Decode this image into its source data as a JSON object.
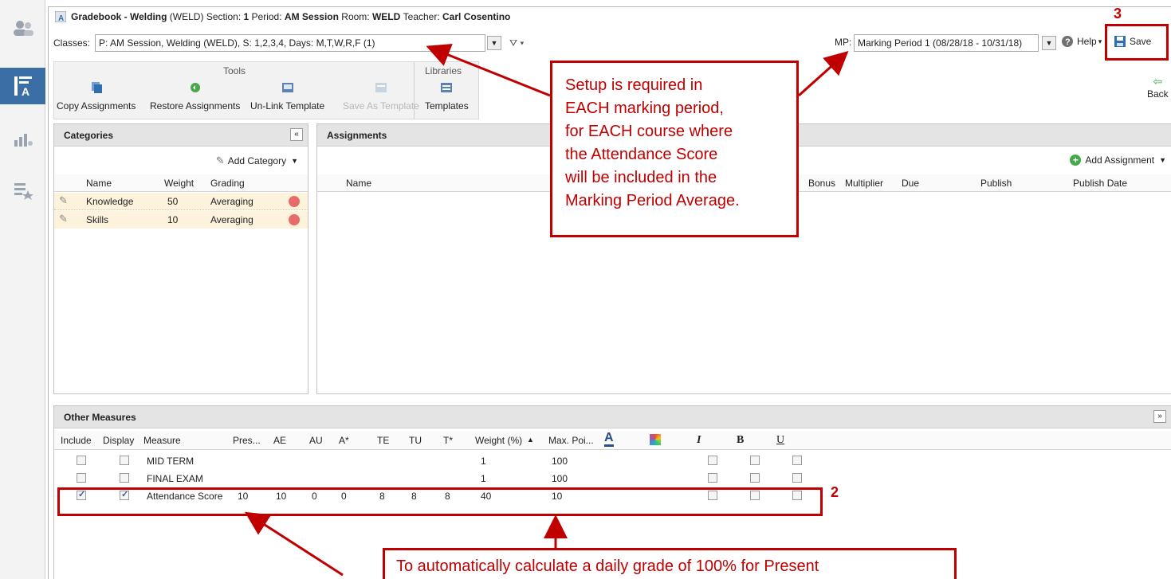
{
  "title_bar": {
    "prefix": "Gradebook - Welding",
    "course_code": "(WELD)",
    "section_label": "Section:",
    "section_value": "1",
    "period_label": "Period:",
    "period_value": "AM Session",
    "room_label": "Room:",
    "room_value": "WELD",
    "teacher_label": "Teacher:",
    "teacher_value": "Carl Cosentino"
  },
  "classes": {
    "label": "Classes:",
    "selected": "P: AM Session, Welding (WELD), S: 1,2,3,4, Days: M,T,W,R,F (1)"
  },
  "marking_period": {
    "label": "MP:",
    "selected": "Marking Period 1 (08/28/18 - 10/31/18)"
  },
  "toolbar": {
    "help_label": "Help",
    "save_label": "Save",
    "back_label": "Back"
  },
  "ribbon": {
    "tools_header": "Tools",
    "libraries_header": "Libraries",
    "buttons": [
      {
        "label": "Copy Assignments",
        "icon": "copy-icon"
      },
      {
        "label": "Restore Assignments",
        "icon": "restore-icon"
      },
      {
        "label": "Un-Link Template",
        "icon": "unlink-icon"
      },
      {
        "label": "Save As Template",
        "icon": "save-template-icon",
        "disabled": true
      },
      {
        "label": "Templates",
        "icon": "templates-icon"
      }
    ]
  },
  "categories": {
    "title": "Categories",
    "add_label": "Add Category",
    "columns": [
      "Name",
      "Weight",
      "Grading"
    ],
    "rows": [
      {
        "name": "Knowledge",
        "weight": "50",
        "grading": "Averaging"
      },
      {
        "name": "Skills",
        "weight": "10",
        "grading": "Averaging"
      }
    ]
  },
  "assignments": {
    "title": "Assignments",
    "add_label": "Add Assignment",
    "columns": [
      "Name",
      "Bonus",
      "Multiplier",
      "Due",
      "Publish",
      "Publish Date"
    ]
  },
  "other_measures": {
    "title": "Other Measures",
    "columns": [
      "Include",
      "Display",
      "Measure",
      "Pres...",
      "AE",
      "AU",
      "A*",
      "TE",
      "TU",
      "T*",
      "Weight (%)",
      "Max. Poi...",
      "I",
      "B",
      "U"
    ],
    "rows": [
      {
        "include": false,
        "display": false,
        "measure": "MID TERM",
        "pres": "",
        "ae": "",
        "au": "",
        "a_star": "",
        "te": "",
        "tu": "",
        "t_star": "",
        "weight": "1",
        "max_points": "100"
      },
      {
        "include": false,
        "display": false,
        "measure": "FINAL EXAM",
        "pres": "",
        "ae": "",
        "au": "",
        "a_star": "",
        "te": "",
        "tu": "",
        "t_star": "",
        "weight": "1",
        "max_points": "100"
      },
      {
        "include": true,
        "display": true,
        "measure": "Attendance Score",
        "pres": "10",
        "ae": "10",
        "au": "0",
        "a_star": "0",
        "te": "8",
        "tu": "8",
        "t_star": "8",
        "weight": "40",
        "max_points": "10"
      }
    ]
  },
  "annotations": {
    "top_callout": [
      "Setup is required in",
      "EACH marking period,",
      "for EACH course where",
      "the Attendance Score",
      "will be included in the",
      "Marking Period Average."
    ],
    "bottom_callout": "To automatically calculate a daily grade of 100% for Present",
    "step_2": "2",
    "step_3": "3"
  },
  "colors": {
    "annotation_red": "#c00000",
    "sidebar_active": "#3a6ea5",
    "category_row_bg": "#fdf3dc"
  }
}
